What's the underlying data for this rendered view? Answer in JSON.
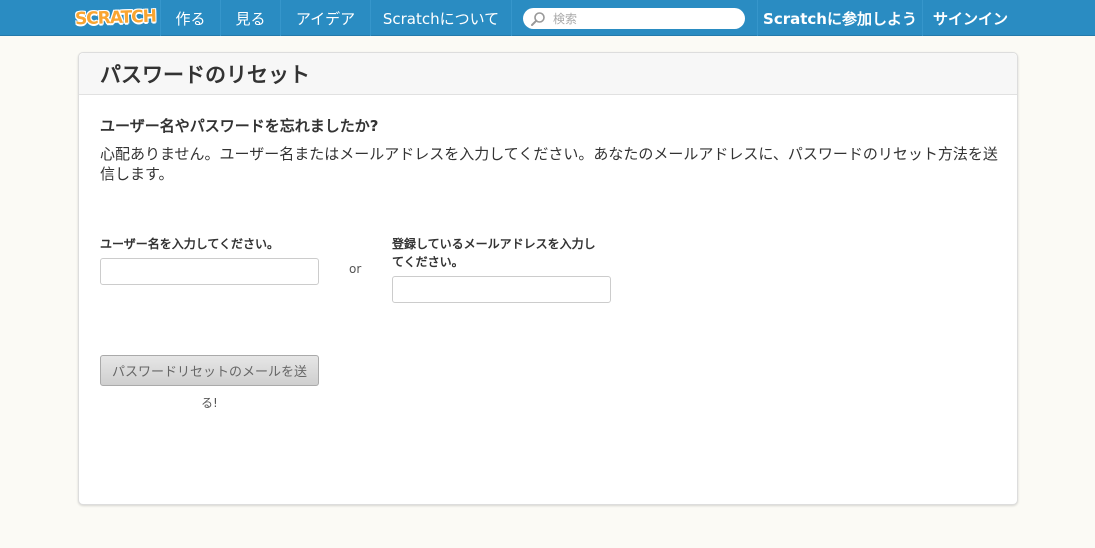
{
  "nav": {
    "logo": "SCRATCH",
    "make": "作る",
    "explore": "見る",
    "ideas": "アイデア",
    "about": "Scratchについて",
    "search_placeholder": "検索",
    "join": "Scratchに参加しよう",
    "signin": "サインイン"
  },
  "page": {
    "title": "パスワードのリセット",
    "question": "ユーザー名やパスワードを忘れましたか?",
    "description": "心配ありません。ユーザー名またはメールアドレスを入力してください。あなたのメールアドレスに、パスワードのリセット方法を送信します。",
    "username_label": "ユーザー名を入力してください。",
    "or": "or",
    "email_label": "登録しているメールアドレスを入力してください。",
    "submit_label": "パスワードリセットのメールを送",
    "submit_overflow": "る!"
  },
  "colors": {
    "nav_bg": "#2a8cc2",
    "page_bg": "#fbfaf5",
    "logo": "#f9a531"
  }
}
